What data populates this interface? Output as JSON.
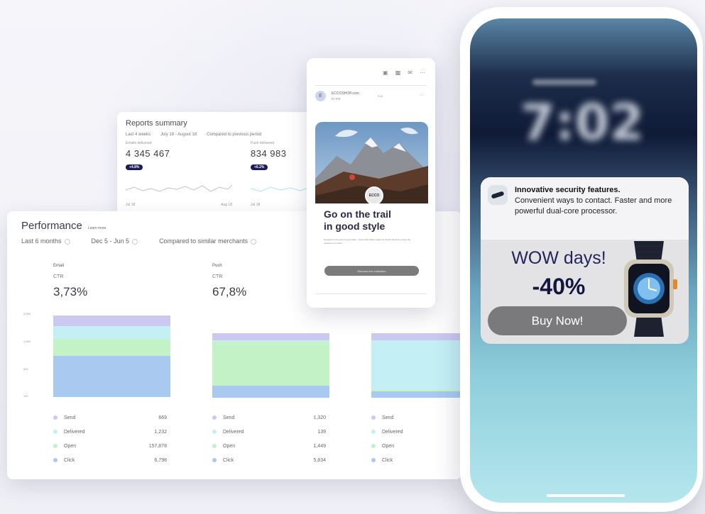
{
  "reports": {
    "title": "Reports summary",
    "filters": [
      "Last 4 weeks",
      "July 18 - August 18",
      "Compared to previous period"
    ],
    "columns": [
      {
        "label": "Emails delivered",
        "value": "4 345 467",
        "badge": "+4.8%",
        "axis": [
          "Jul 18",
          "Aug 18"
        ]
      },
      {
        "label": "Push delivered",
        "value": "834 983",
        "badge": "+6.2%",
        "axis": [
          "Jul 18",
          ""
        ]
      }
    ]
  },
  "performance": {
    "title": "Performance",
    "link": "Learn more",
    "filters": [
      "Last 6 months",
      "Dec 5 - Jun 5",
      "Compared to similar merchants"
    ],
    "y_ticks": [
      "2,000",
      "1,000",
      "500",
      "100"
    ],
    "colors": {
      "send": "#cbc8f2",
      "delivered": "#c4f0f5",
      "open": "#c2f2c6",
      "click": "#a9c9f1"
    },
    "columns": [
      {
        "name": "Email",
        "metric": "CTR",
        "value": "3,73%",
        "legend": [
          {
            "label": "Send",
            "value": "669"
          },
          {
            "label": "Delivered",
            "value": "1,232"
          },
          {
            "label": "Open",
            "value": "157,878"
          },
          {
            "label": "Click",
            "value": "6,798"
          }
        ]
      },
      {
        "name": "Push",
        "metric": "CTR",
        "value": "67,8%",
        "legend": [
          {
            "label": "Send",
            "value": "1,320"
          },
          {
            "label": "Delivered",
            "value": "139"
          },
          {
            "label": "Open",
            "value": "1,449"
          },
          {
            "label": "Click",
            "value": "5,834"
          }
        ]
      },
      {
        "name": "",
        "metric": "",
        "value": "",
        "legend": [
          {
            "label": "Send",
            "value": ""
          },
          {
            "label": "Delivered",
            "value": ""
          },
          {
            "label": "Open",
            "value": ""
          },
          {
            "label": "Click",
            "value": ""
          }
        ]
      }
    ]
  },
  "email_preview": {
    "sender_initial": "E",
    "sender": "ECCOSHOP.com",
    "to": "to me",
    "time": "9:30",
    "brand": "ECCO",
    "headline_1": "Go on the trail",
    "headline_2": "in good style",
    "body": "Designed in the spirit of good style - shoes that make it easier to hit the trail and to enjoy the outdoors in comfort.",
    "cta": "Discover the collection"
  },
  "phone": {
    "time": "7:02",
    "notification": {
      "title": "Innovative security features.",
      "body": "Convenient ways to contact. Faster and more powerful dual-core processor.",
      "promo": "WOW days!",
      "discount": "-40%",
      "button": "Buy Now!"
    }
  }
}
